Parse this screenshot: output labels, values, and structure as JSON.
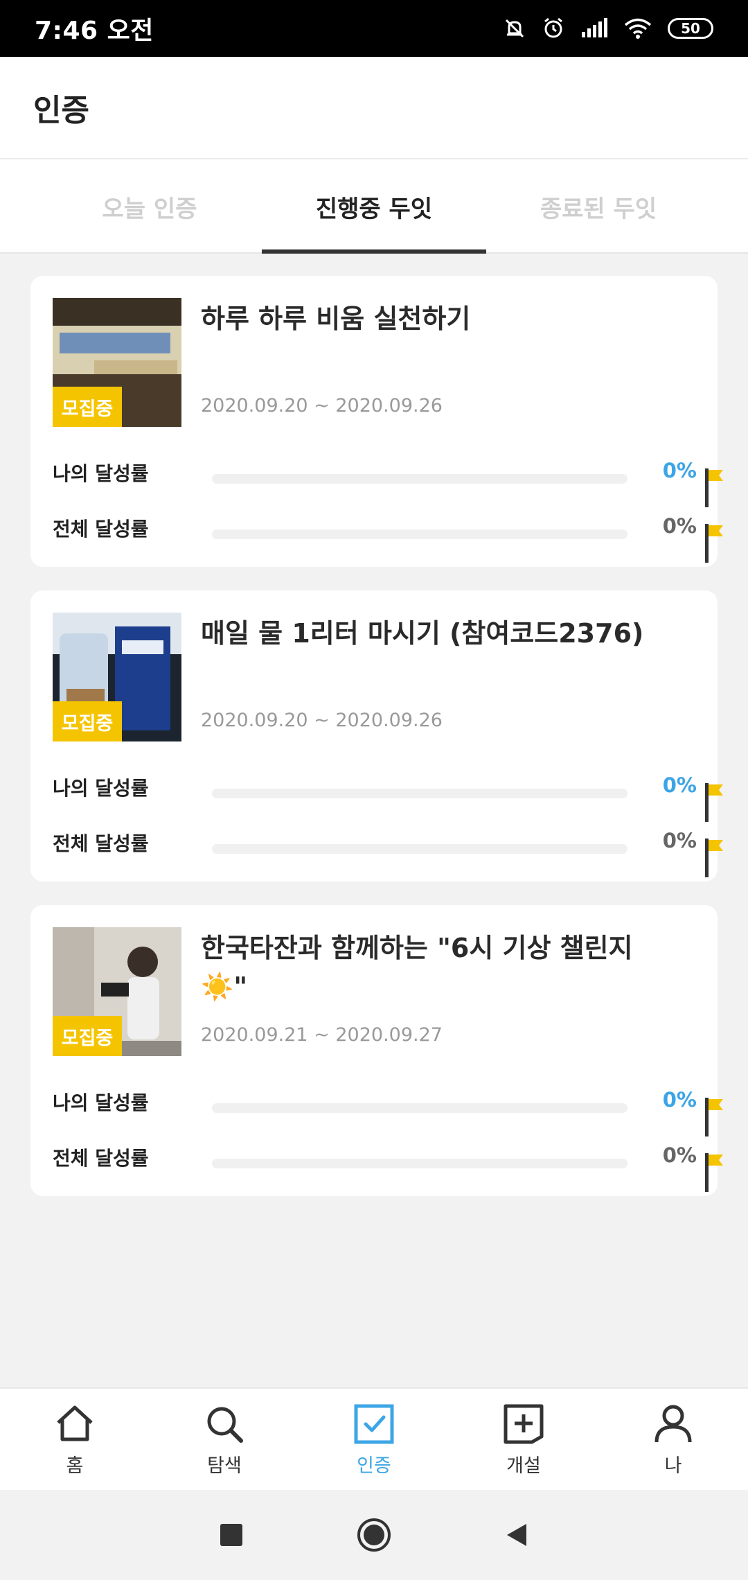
{
  "status_bar": {
    "time": "7:46 오전",
    "battery": "50"
  },
  "header": {
    "title": "인증"
  },
  "tabs": [
    {
      "label": "오늘 인증",
      "active": false
    },
    {
      "label": "진행중 두잇",
      "active": true
    },
    {
      "label": "종료된 두잇",
      "active": false
    }
  ],
  "cards": [
    {
      "badge": "모집중",
      "title": "하루 하루  비움 실천하기",
      "dates": "2020.09.20 ~ 2020.09.26",
      "my_rate_label": "나의 달성률",
      "my_rate": "0%",
      "total_rate_label": "전체 달성률",
      "total_rate": "0%",
      "my_progress": 0,
      "total_progress": 0
    },
    {
      "badge": "모집중",
      "title": "매일 물 1리터 마시기 (참여코드2376)",
      "dates": "2020.09.20 ~ 2020.09.26",
      "my_rate_label": "나의 달성률",
      "my_rate": "0%",
      "total_rate_label": "전체 달성률",
      "total_rate": "0%",
      "my_progress": 0,
      "total_progress": 0
    },
    {
      "badge": "모집중",
      "title": "한국타잔과 함께하는 \"6시 기상 챌린지 ☀️\"",
      "dates": "2020.09.21 ~ 2020.09.27",
      "my_rate_label": "나의 달성률",
      "my_rate": "0%",
      "total_rate_label": "전체 달성률",
      "total_rate": "0%",
      "my_progress": 0,
      "total_progress": 0
    }
  ],
  "bottom_nav": [
    {
      "label": "홈",
      "icon": "home-icon",
      "active": false
    },
    {
      "label": "탐색",
      "icon": "search-icon",
      "active": false
    },
    {
      "label": "인증",
      "icon": "check-square-icon",
      "active": true
    },
    {
      "label": "개설",
      "icon": "add-square-icon",
      "active": false
    },
    {
      "label": "나",
      "icon": "person-icon",
      "active": false
    }
  ],
  "colors": {
    "accent": "#3ca5e6",
    "badge": "#f5c400",
    "flag": "#f5c400"
  }
}
